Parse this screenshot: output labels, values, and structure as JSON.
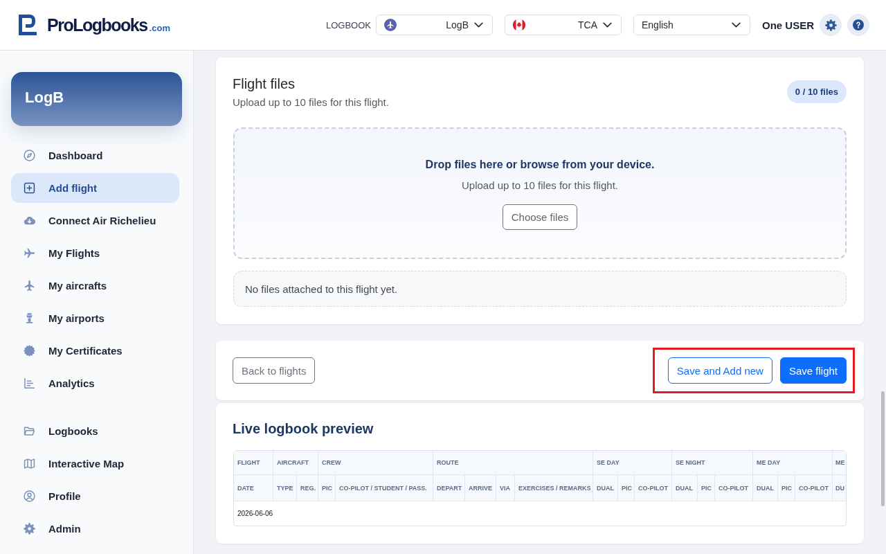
{
  "header": {
    "brand": {
      "name": "ProLogbooks",
      "domain": ".com"
    },
    "logbook_label": "LOGBOOK",
    "selects": [
      {
        "kind": "logbook",
        "value": "LogB"
      },
      {
        "kind": "operator",
        "value": "TCA"
      },
      {
        "kind": "language",
        "value": "English"
      }
    ],
    "user": "One USER"
  },
  "sidebar": {
    "logbook": "LogB",
    "sections": [
      {
        "items": [
          {
            "label": "Dashboard",
            "selected": false
          },
          {
            "label": "Add flight",
            "selected": true
          },
          {
            "label": "Connect Air Richelieu",
            "selected": false
          },
          {
            "label": "My Flights",
            "selected": false
          },
          {
            "label": "My aircrafts",
            "selected": false
          },
          {
            "label": "My airports",
            "selected": false
          },
          {
            "label": "My Certificates",
            "selected": false
          },
          {
            "label": "Analytics",
            "selected": false
          }
        ]
      },
      {
        "items": [
          {
            "label": "Logbooks",
            "selected": false
          },
          {
            "label": "Interactive Map",
            "selected": false
          },
          {
            "label": "Profile",
            "selected": false
          },
          {
            "label": "Admin",
            "selected": false
          }
        ]
      }
    ]
  },
  "flight_files": {
    "title": "Flight files",
    "subtitle": "Upload up to 10 files for this flight.",
    "count_badge": "0 / 10 files",
    "dropzone": {
      "heading": "Drop files here or browse from your device.",
      "hint": "Upload up to 10 files for this flight.",
      "button": "Choose files"
    },
    "empty_message": "No files attached to this flight yet."
  },
  "actions": {
    "back_button": "Back to flights",
    "highlighted": true,
    "buttons": [
      {
        "kind": "outline",
        "label": "Save and Add new"
      },
      {
        "kind": "primary",
        "label": "Save flight"
      }
    ]
  },
  "preview": {
    "title": "Live logbook preview",
    "groups": [
      {
        "label": "FLIGHT",
        "columns": [
          "DATE"
        ]
      },
      {
        "label": "AIRCRAFT",
        "columns": [
          "TYPE",
          "REG."
        ]
      },
      {
        "label": "CREW",
        "columns": [
          "PIC",
          "CO-PILOT / STUDENT / PASS."
        ]
      },
      {
        "label": "ROUTE",
        "columns": [
          "DEPART",
          "ARRIVE",
          "VIA",
          "EXERCISES / REMARKS"
        ]
      },
      {
        "label": "SE DAY",
        "columns": [
          "DUAL",
          "PIC",
          "CO-PILOT"
        ]
      },
      {
        "label": "SE NIGHT",
        "columns": [
          "DUAL",
          "PIC",
          "CO-PILOT"
        ]
      },
      {
        "label": "ME DAY",
        "columns": [
          "DUAL",
          "PIC",
          "CO-PILOT"
        ]
      },
      {
        "label": "ME",
        "columns": [
          "DU"
        ]
      }
    ],
    "rows": [
      {
        "cells": [
          "2026-06-06"
        ]
      }
    ]
  }
}
